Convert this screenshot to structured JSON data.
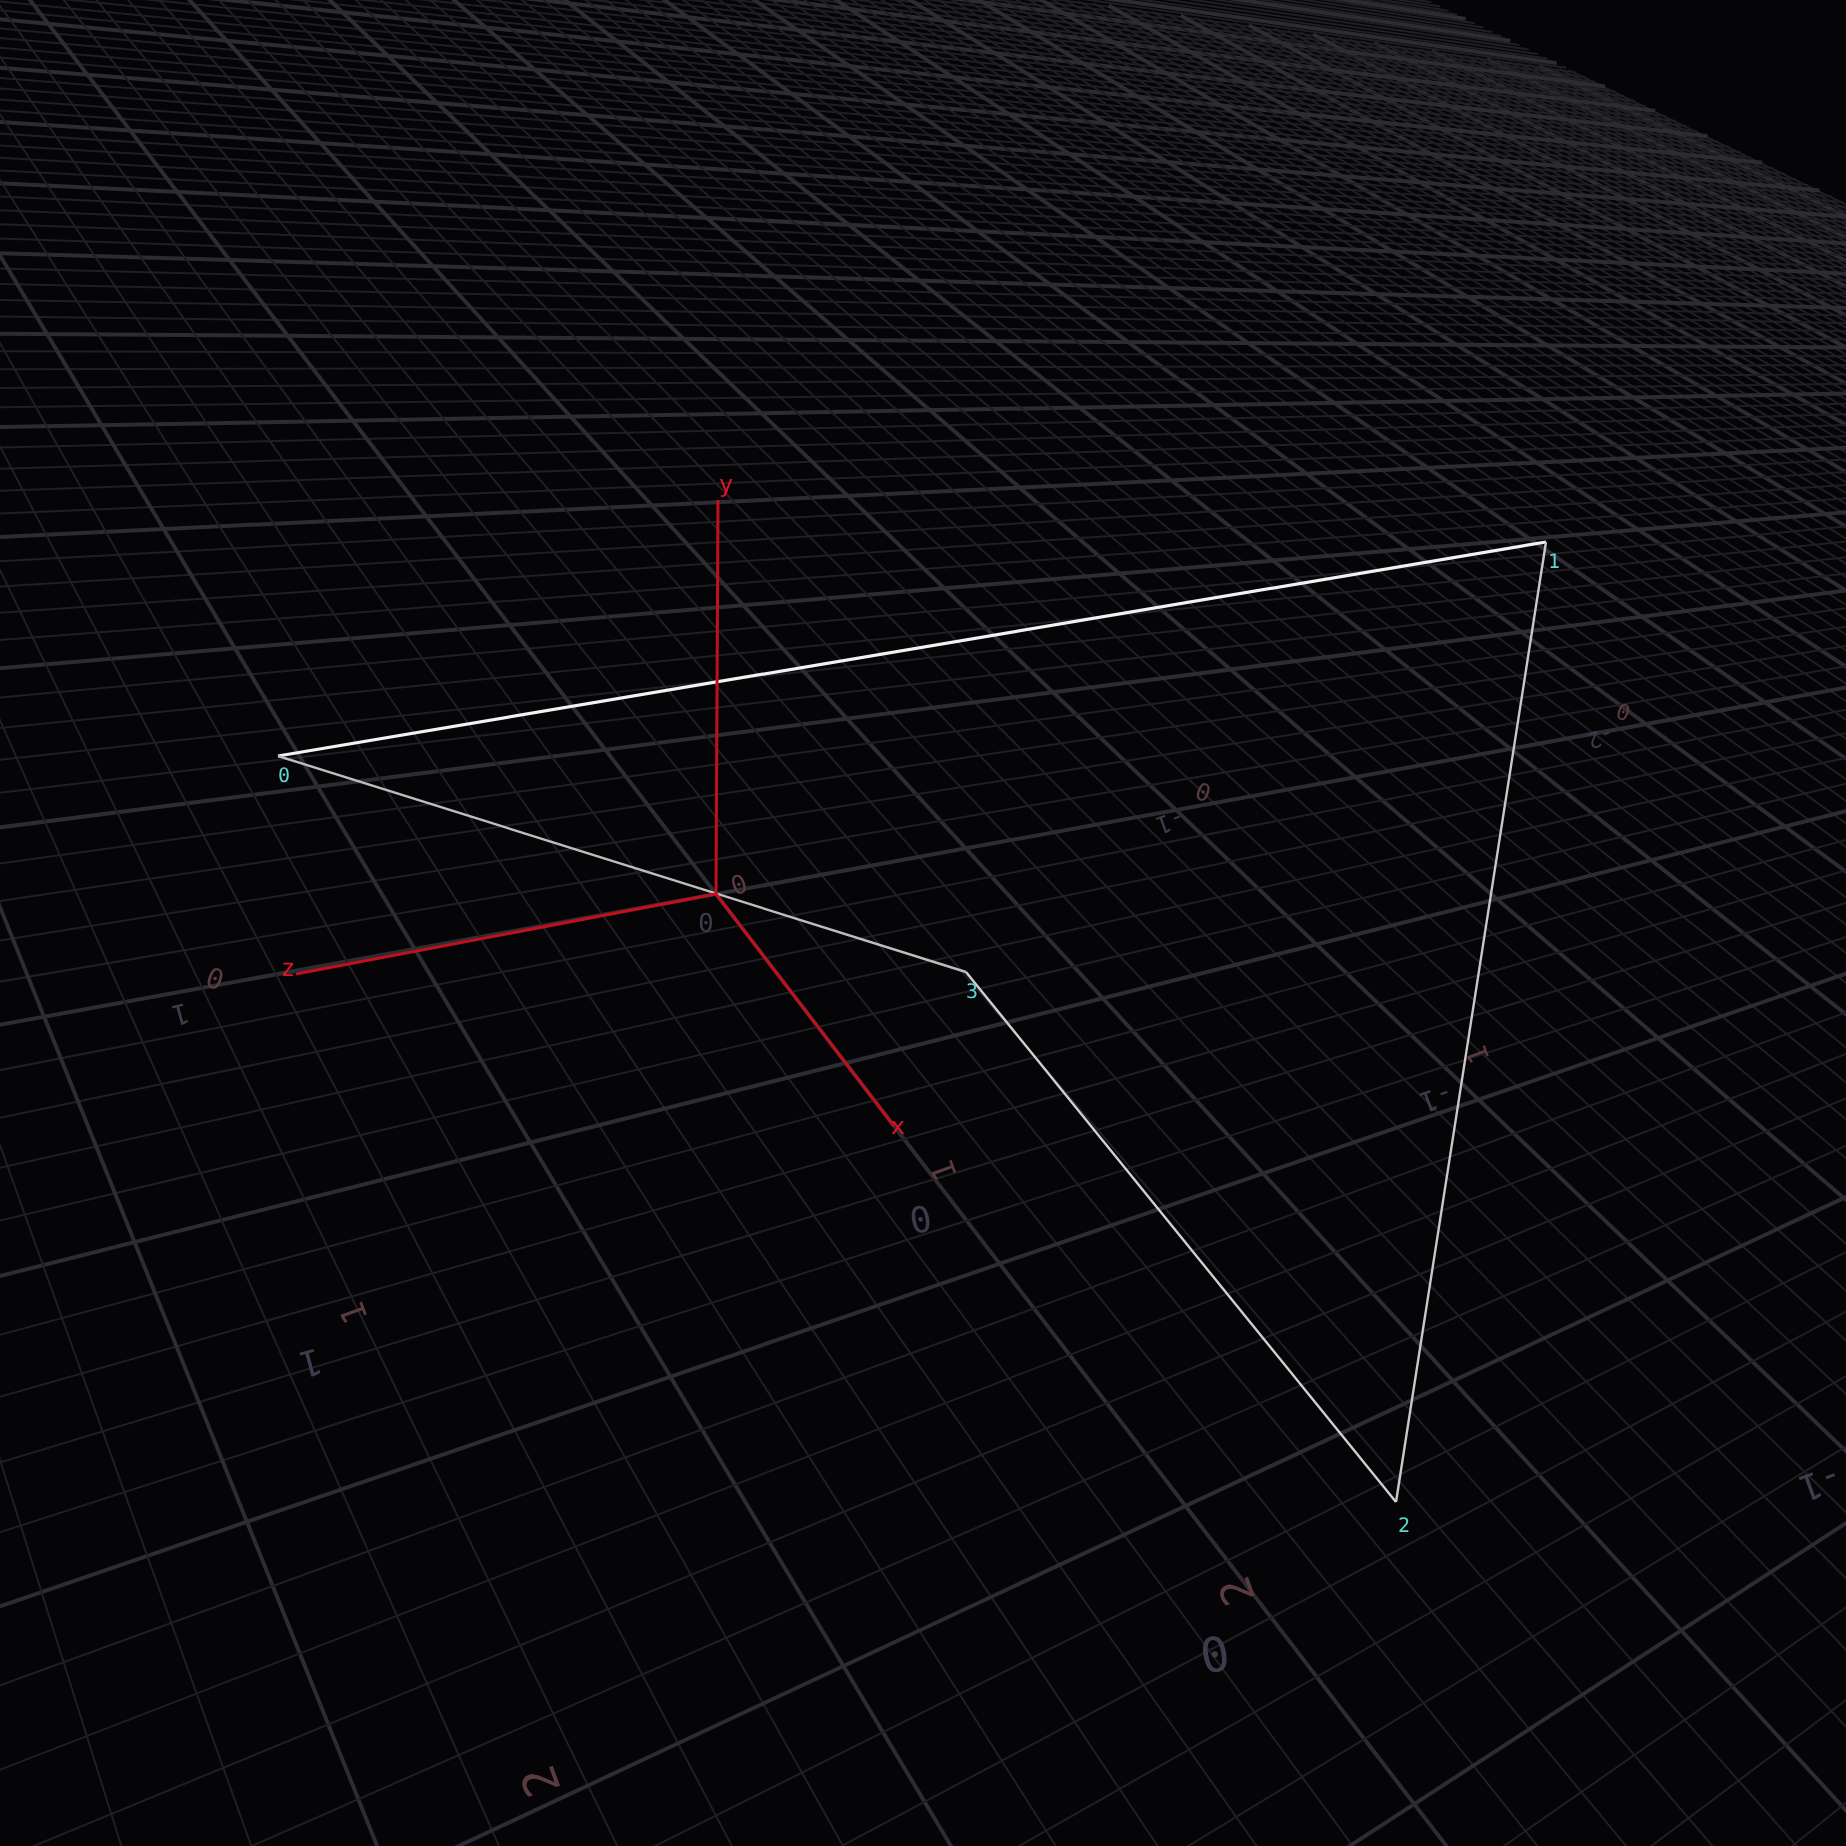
{
  "axes": [
    {
      "label": "x"
    },
    {
      "label": "y"
    },
    {
      "label": "z"
    }
  ],
  "origin_labels": [
    "0",
    "0"
  ],
  "vertices": [
    {
      "label": "0"
    },
    {
      "label": "1"
    },
    {
      "label": "2"
    },
    {
      "label": "3"
    }
  ],
  "grid_labels": [
    {
      "text": "0",
      "color": "#5a3c40"
    },
    {
      "text": "-2",
      "color": "#3c3c4c"
    },
    {
      "text": "0",
      "color": "#5a3c40"
    },
    {
      "text": "-1",
      "color": "#3c3c4c"
    },
    {
      "text": "1",
      "color": "#5a3c40"
    },
    {
      "text": "-1",
      "color": "#3c3c4c"
    },
    {
      "text": "1",
      "color": "#5a3c40"
    },
    {
      "text": "0",
      "color": "#3c3c4c"
    },
    {
      "text": "1",
      "color": "#5a3c40"
    },
    {
      "text": "1",
      "color": "#3c3c4c"
    },
    {
      "text": "2",
      "color": "#5a3c40"
    },
    {
      "text": "0",
      "color": "#3c3c4c"
    },
    {
      "text": "0",
      "color": "#5a3c40"
    },
    {
      "text": "1",
      "color": "#3c3c4c"
    },
    {
      "text": "2",
      "color": "#5a3c40"
    },
    {
      "text": "-1",
      "color": "#3c3c4c"
    }
  ]
}
